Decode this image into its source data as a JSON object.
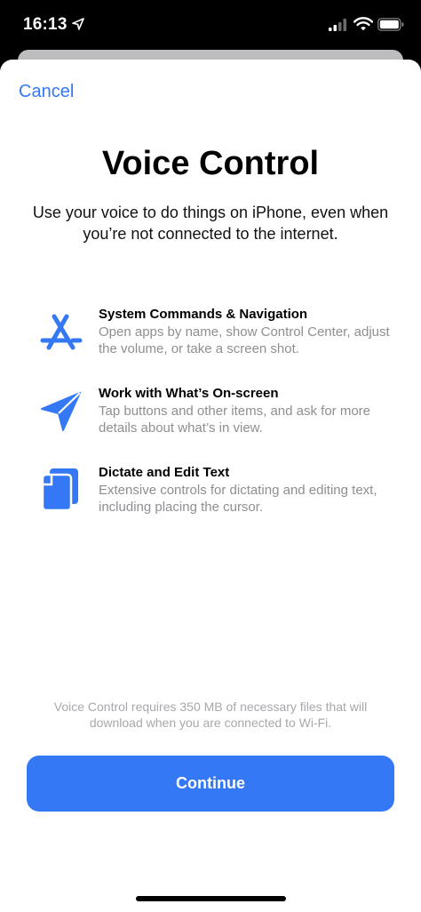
{
  "status_bar": {
    "time": "16:13",
    "icons": [
      "location-arrow-icon",
      "cellular-signal-icon",
      "wifi-icon",
      "battery-icon"
    ]
  },
  "sheet": {
    "cancel_label": "Cancel",
    "title": "Voice Control",
    "subtitle": "Use your voice to do things on iPhone, even when you’re not connected to the internet.",
    "features": [
      {
        "icon": "app-store-icon",
        "title": "System Commands & Navigation",
        "description": "Open apps by name, show Control Center, adjust the volume, or take a screen shot."
      },
      {
        "icon": "paper-plane-icon",
        "title": "Work with What’s On-screen",
        "description": "Tap buttons and other items, and ask for more details about what’s in view."
      },
      {
        "icon": "documents-icon",
        "title": "Dictate and Edit Text",
        "description": "Extensive controls for dictating and editing text, including placing the cursor."
      }
    ],
    "footnote": "Voice Control requires 350 MB of necessary files that will download when you are connected to Wi-Fi.",
    "continue_label": "Continue"
  },
  "colors": {
    "accent": "#3478f6",
    "secondary_text": "#8e8e93",
    "footnote_text": "#a7a7ac"
  }
}
